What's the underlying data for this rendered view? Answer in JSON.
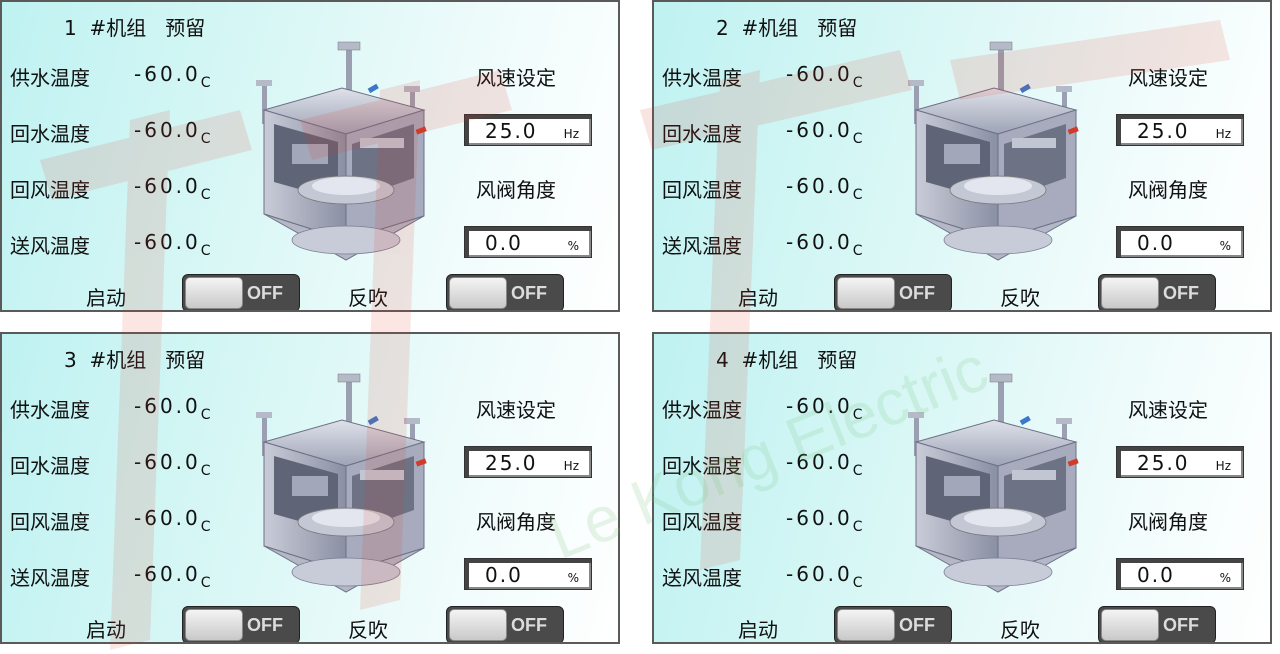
{
  "units": [
    {
      "title": "1  #机组   预留",
      "readings": [
        {
          "label": "供水温度",
          "value": "-60.0",
          "unit": "C"
        },
        {
          "label": "回水温度",
          "value": "-60.0",
          "unit": "C"
        },
        {
          "label": "回风温度",
          "value": "-60.0",
          "unit": "C"
        },
        {
          "label": "送风温度",
          "value": "-60.0",
          "unit": "C"
        }
      ],
      "fan_speed": {
        "label": "风速设定",
        "value": "25.0",
        "unit": "Hz"
      },
      "damper": {
        "label": "风阀角度",
        "value": "0.0",
        "unit": "%"
      },
      "start": {
        "label": "启动",
        "state": "OFF"
      },
      "reverse": {
        "label": "反吹",
        "state": "OFF"
      }
    },
    {
      "title": "2  #机组   预留",
      "readings": [
        {
          "label": "供水温度",
          "value": "-60.0",
          "unit": "C"
        },
        {
          "label": "回水温度",
          "value": "-60.0",
          "unit": "C"
        },
        {
          "label": "回风温度",
          "value": "-60.0",
          "unit": "C"
        },
        {
          "label": "送风温度",
          "value": "-60.0",
          "unit": "C"
        }
      ],
      "fan_speed": {
        "label": "风速设定",
        "value": "25.0",
        "unit": "Hz"
      },
      "damper": {
        "label": "风阀角度",
        "value": "0.0",
        "unit": "%"
      },
      "start": {
        "label": "启动",
        "state": "OFF"
      },
      "reverse": {
        "label": "反吹",
        "state": "OFF"
      }
    },
    {
      "title": "3  #机组   预留",
      "readings": [
        {
          "label": "供水温度",
          "value": "-60.0",
          "unit": "C"
        },
        {
          "label": "回水温度",
          "value": "-60.0",
          "unit": "C"
        },
        {
          "label": "回风温度",
          "value": "-60.0",
          "unit": "C"
        },
        {
          "label": "送风温度",
          "value": "-60.0",
          "unit": "C"
        }
      ],
      "fan_speed": {
        "label": "风速设定",
        "value": "25.0",
        "unit": "Hz"
      },
      "damper": {
        "label": "风阀角度",
        "value": "0.0",
        "unit": "%"
      },
      "start": {
        "label": "启动",
        "state": "OFF"
      },
      "reverse": {
        "label": "反吹",
        "state": "OFF"
      }
    },
    {
      "title": "4  #机组   预留",
      "readings": [
        {
          "label": "供水温度",
          "value": "-60.0",
          "unit": "C"
        },
        {
          "label": "回水温度",
          "value": "-60.0",
          "unit": "C"
        },
        {
          "label": "回风温度",
          "value": "-60.0",
          "unit": "C"
        },
        {
          "label": "送风温度",
          "value": "-60.0",
          "unit": "C"
        }
      ],
      "fan_speed": {
        "label": "风速设定",
        "value": "25.0",
        "unit": "Hz"
      },
      "damper": {
        "label": "风阀角度",
        "value": "0.0",
        "unit": "%"
      },
      "start": {
        "label": "启动",
        "state": "OFF"
      },
      "reverse": {
        "label": "反吹",
        "state": "OFF"
      }
    }
  ],
  "watermark": {
    "text": "Le Kong Electric",
    "color": "#e03a2a"
  },
  "colors": {
    "panel_border": "#5a5a5a",
    "toggle_off": "#4a4a4a"
  },
  "icons": {
    "unit_image": "air-handling-unit-illustration"
  }
}
